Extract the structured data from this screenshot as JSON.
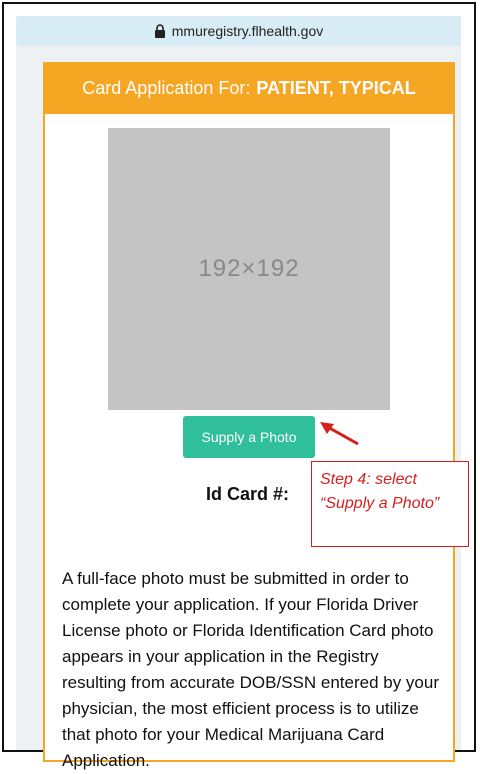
{
  "browser": {
    "url": "mmuregistry.flhealth.gov",
    "lock_icon": "lock-icon"
  },
  "card": {
    "header_prefix": "Card Application For:",
    "header_name": "PATIENT, TYPICAL",
    "photo_placeholder": "192×192",
    "supply_button": "Supply a Photo",
    "id_card_label": "Id Card #:",
    "description": "A full-face photo must be submitted in order to complete your application. If your Florida Driver License photo or Florida Identification Card photo appears in your application in the Registry resulting from accurate DOB/SSN entered by your physician, the most efficient process is to utilize that photo for your Medical Marijuana Card Application."
  },
  "annotation": {
    "line1": "Step 4: select",
    "line2": "“Supply a Photo”"
  },
  "colors": {
    "header": "#f5a623",
    "button": "#2fbf9a",
    "annotation": "#d61e1e",
    "urlbar": "#d7ecf4"
  }
}
